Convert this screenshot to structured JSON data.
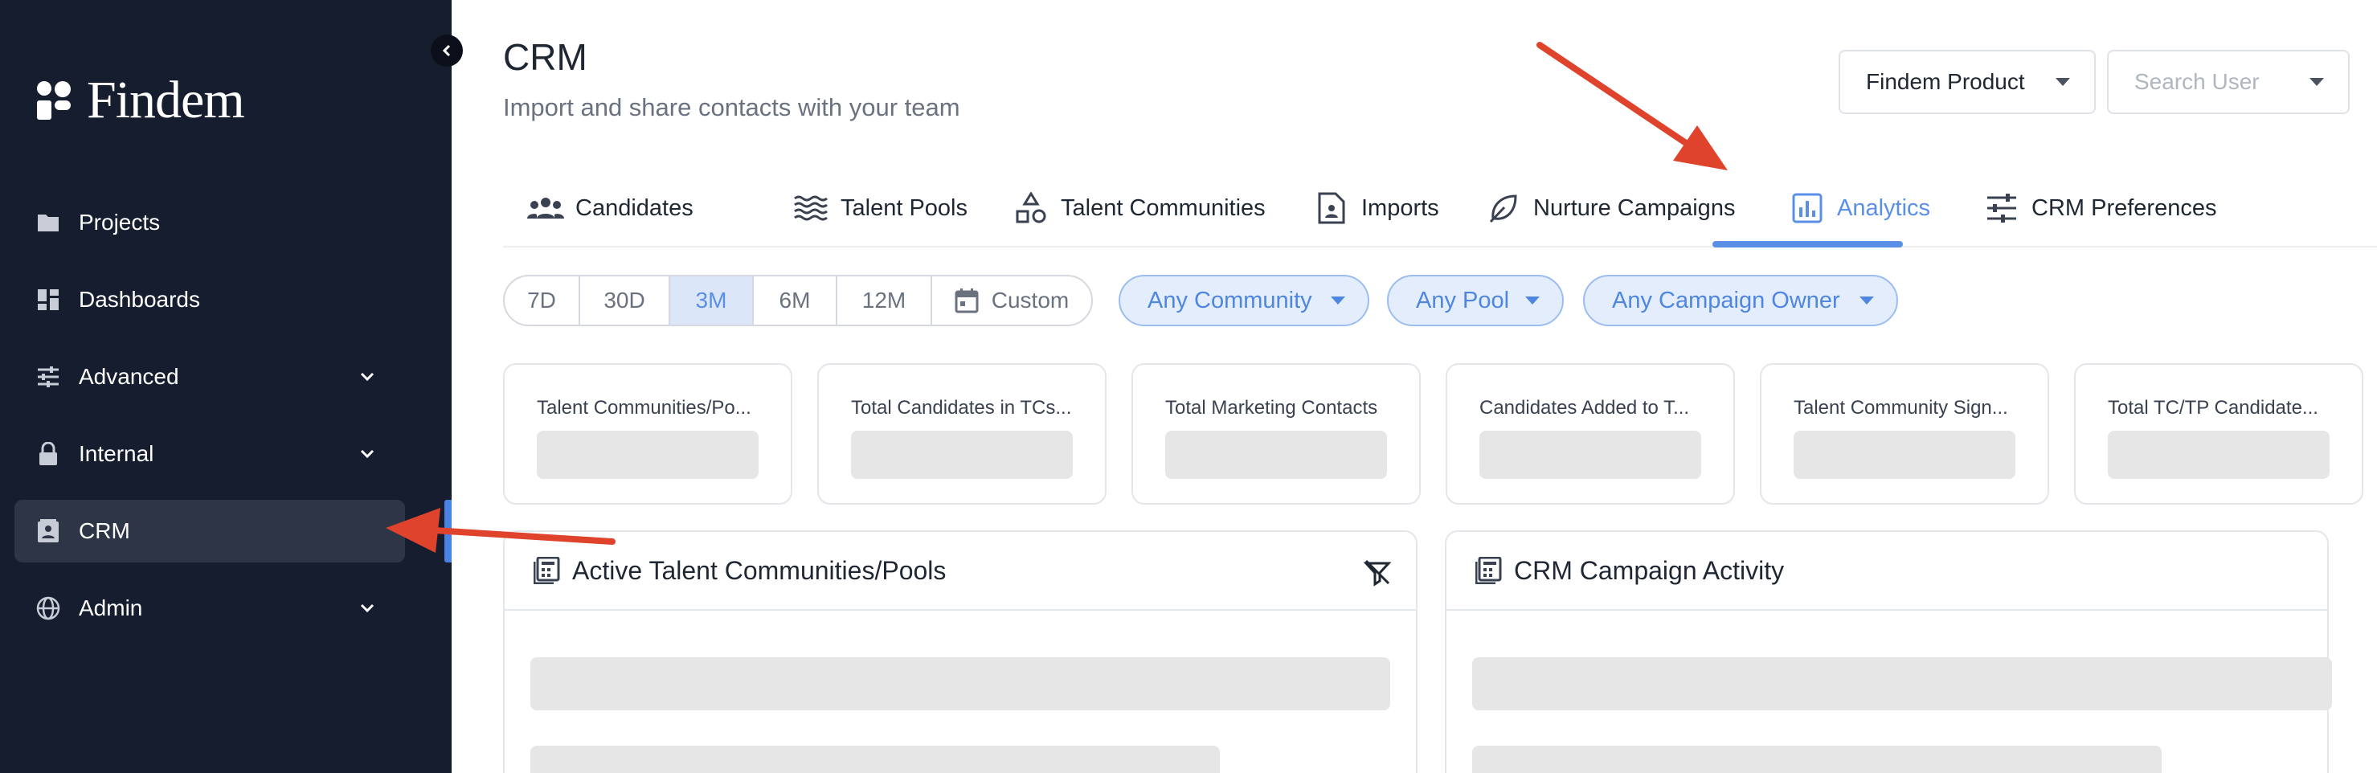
{
  "sidebar": {
    "logo_text": "Findem",
    "items": [
      {
        "label": "Projects",
        "icon": "folder-icon"
      },
      {
        "label": "Dashboards",
        "icon": "dashboard-icon"
      },
      {
        "label": "Advanced",
        "icon": "sliders-icon",
        "expandable": true
      },
      {
        "label": "Internal",
        "icon": "lock-icon",
        "expandable": true
      },
      {
        "label": "CRM",
        "icon": "contact-card-icon",
        "active": true
      },
      {
        "label": "Admin",
        "icon": "globe-icon",
        "expandable": true
      }
    ]
  },
  "header": {
    "title": "CRM",
    "subtitle": "Import and share contacts with your team",
    "product_select": "Findem Product",
    "user_select_placeholder": "Search User"
  },
  "tabs": [
    {
      "label": "Candidates",
      "icon": "people-icon"
    },
    {
      "label": "Talent Pools",
      "icon": "waves-icon"
    },
    {
      "label": "Talent Communities",
      "icon": "shapes-icon"
    },
    {
      "label": "Imports",
      "icon": "document-person-icon"
    },
    {
      "label": "Nurture Campaigns",
      "icon": "leaf-icon"
    },
    {
      "label": "Analytics",
      "icon": "bar-chart-icon",
      "active": true
    },
    {
      "label": "CRM Preferences",
      "icon": "tune-icon"
    }
  ],
  "filters": {
    "ranges": [
      "7D",
      "30D",
      "3M",
      "6M",
      "12M",
      "Custom"
    ],
    "active_range": "3M",
    "chips": [
      "Any Community",
      "Any Pool",
      "Any Campaign Owner"
    ]
  },
  "stats": [
    "Talent Communities/Po...",
    "Total Candidates in TCs...",
    "Total Marketing Contacts",
    "Candidates Added to T...",
    "Talent Community Sign...",
    "Total TC/TP Candidate..."
  ],
  "panels": [
    {
      "title": "Active Talent Communities/Pools"
    },
    {
      "title": "CRM Campaign Activity"
    }
  ],
  "colors": {
    "sidebar_bg": "#161d2f",
    "accent": "#5a8fe6",
    "annotation_arrow": "#e0432b"
  }
}
